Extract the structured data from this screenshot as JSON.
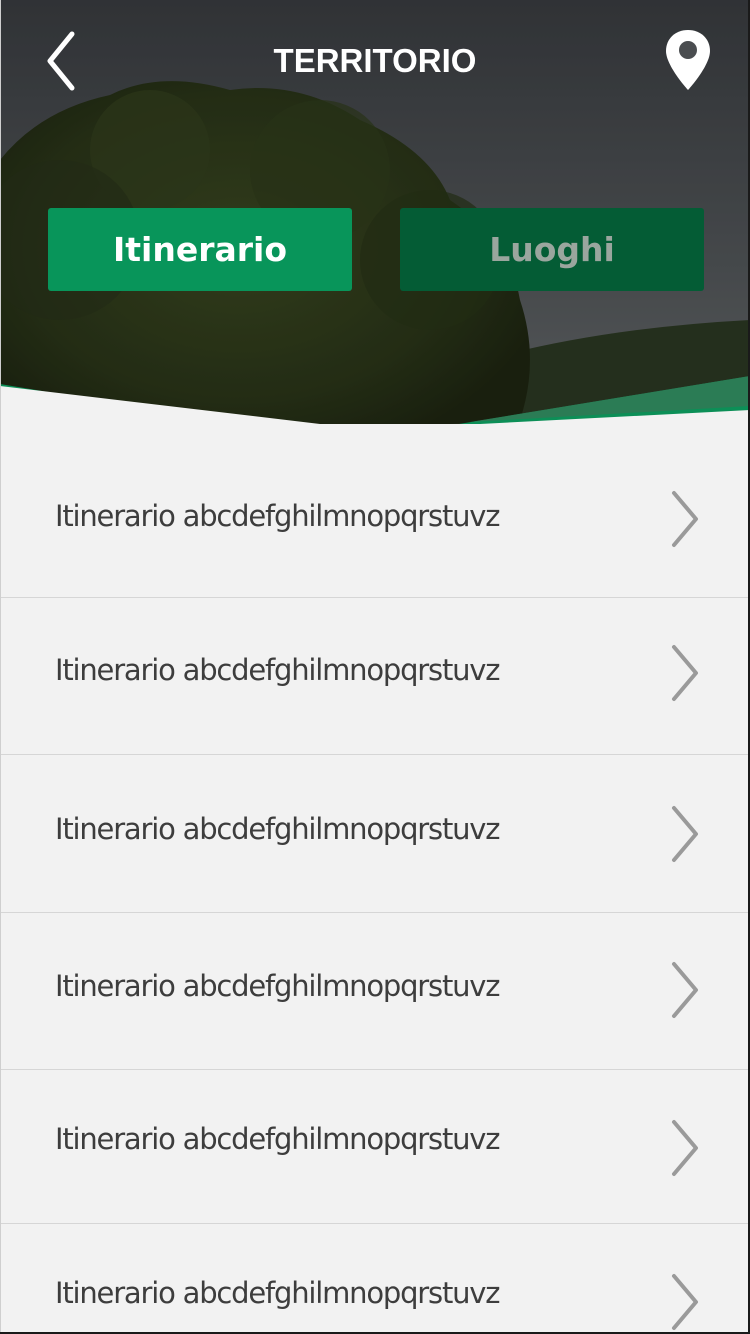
{
  "header": {
    "title": "TERRITORIO",
    "back_icon": "chevron-left-icon",
    "map_icon": "map-pin-icon"
  },
  "tabs": [
    {
      "label": "Itinerario",
      "active": true
    },
    {
      "label": "Luoghi",
      "active": false
    }
  ],
  "colors": {
    "accent": "#08955a",
    "accent_dark": "#045c35",
    "list_background": "#f2f2f2",
    "item_text": "#3d3d3d",
    "chevron": "#9a9a9a"
  },
  "list": {
    "items": [
      {
        "label": "Itinerario abcdefghilmnopqrstuvz"
      },
      {
        "label": "Itinerario abcdefghilmnopqrstuvz"
      },
      {
        "label": "Itinerario abcdefghilmnopqrstuvz"
      },
      {
        "label": "Itinerario abcdefghilmnopqrstuvz"
      },
      {
        "label": "Itinerario abcdefghilmnopqrstuvz"
      },
      {
        "label": "Itinerario abcdefghilmnopqrstuvz"
      }
    ],
    "chevron_icon": "chevron-right-icon"
  }
}
